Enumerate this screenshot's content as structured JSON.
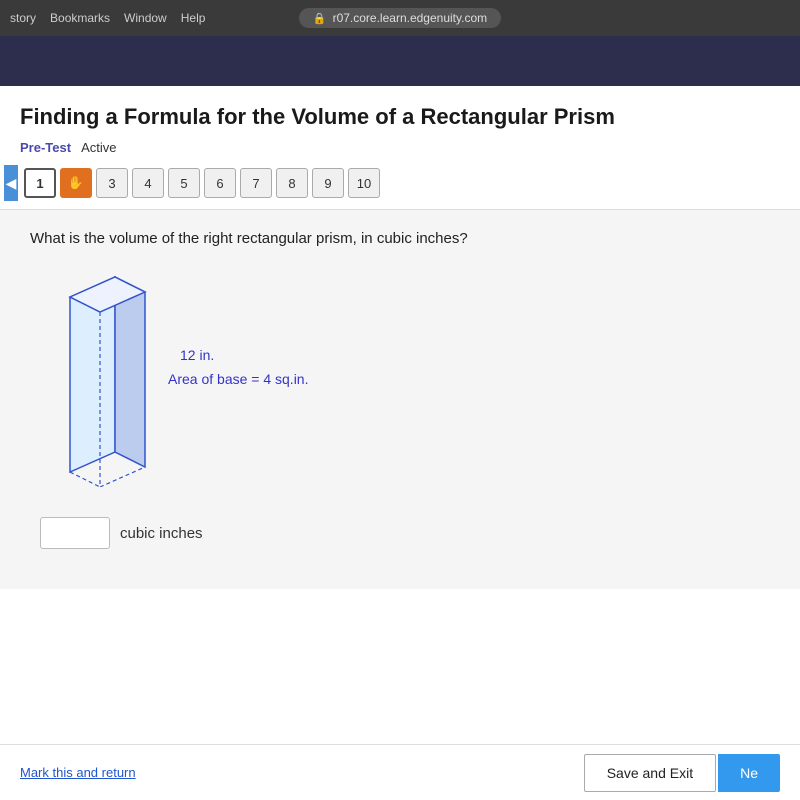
{
  "browser": {
    "menu_items": [
      "story",
      "Bookmarks",
      "Window",
      "Help"
    ],
    "url": "r07.core.learn.edgenuity.com",
    "lock_symbol": "🔒"
  },
  "lesson": {
    "title": "Finding a Formula for the Volume of a Rectangular Prism",
    "pretest_label": "Pre-Test",
    "active_label": "Active"
  },
  "question_numbers": {
    "current": "1",
    "flagged": "2",
    "items": [
      "1",
      "2",
      "3",
      "4",
      "5",
      "6",
      "7",
      "8",
      "9",
      "10"
    ]
  },
  "question": {
    "text": "What is the volume of the right rectangular prism, in cubic inches?",
    "prism_height_label": "12 in.",
    "area_label": "Area of base = 4 sq.in.",
    "answer_placeholder": "",
    "answer_unit": "cubic inches"
  },
  "bottom": {
    "mark_return_label": "Mark this and return",
    "save_exit_label": "Save and Exit",
    "next_label": "Ne"
  }
}
